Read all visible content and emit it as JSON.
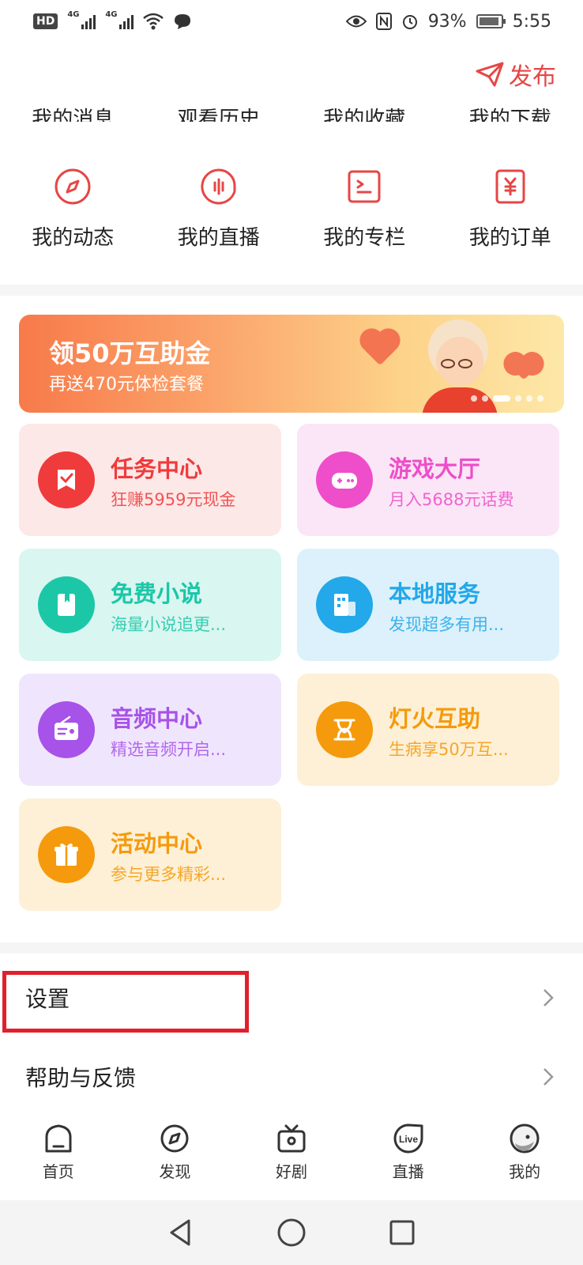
{
  "status_bar": {
    "network_badge": "HD",
    "sim1": "4G",
    "sim2": "4G",
    "battery": "93%",
    "battery_level": 0.93,
    "time": "5:55"
  },
  "header": {
    "publish_label": "发布"
  },
  "partial_row": [
    "我的消息",
    "观看历史",
    "我的收藏",
    "我的下载"
  ],
  "shortcuts": [
    {
      "label": "我的动态",
      "icon": "compass-icon"
    },
    {
      "label": "我的直播",
      "icon": "voice-play-icon"
    },
    {
      "label": "我的专栏",
      "icon": "column-icon"
    },
    {
      "label": "我的订单",
      "icon": "yuan-order-icon"
    }
  ],
  "banner": {
    "title": "领50万互助金",
    "subtitle": "再送470元体检套餐",
    "active_page": 3,
    "page_count": 6
  },
  "cards": [
    {
      "title": "任务中心",
      "sub": "狂赚5959元现金",
      "icon": "task-icon",
      "color": "#ef3b3b",
      "bg": "#fde8e8"
    },
    {
      "title": "游戏大厅",
      "sub": "月入5688元话费",
      "icon": "gamepad-icon",
      "color": "#ee4ec9",
      "bg": "#fbe6f7"
    },
    {
      "title": "免费小说",
      "sub": "海量小说追更...",
      "icon": "book-icon",
      "color": "#1cc7a8",
      "bg": "#d9f6f1"
    },
    {
      "title": "本地服务",
      "sub": "发现超多有用...",
      "icon": "building-icon",
      "color": "#23a8e9",
      "bg": "#dcf1fb"
    },
    {
      "title": "音频中心",
      "sub": "精选音频开启...",
      "icon": "radio-icon",
      "color": "#a752e8",
      "bg": "#efe6fd"
    },
    {
      "title": "灯火互助",
      "sub": "生病享50万互...",
      "icon": "mutual-aid-icon",
      "color": "#f59a0c",
      "bg": "#fdf0d6"
    },
    {
      "title": "活动中心",
      "sub": "参与更多精彩...",
      "icon": "gift-icon",
      "color": "#f59a0c",
      "bg": "#fdf0d6"
    }
  ],
  "list": [
    {
      "label": "设置"
    },
    {
      "label": "帮助与反馈"
    }
  ],
  "tabs": [
    {
      "label": "首页",
      "icon": "home-icon"
    },
    {
      "label": "发现",
      "icon": "discover-icon"
    },
    {
      "label": "好剧",
      "icon": "tv-icon"
    },
    {
      "label": "直播",
      "icon": "live-icon"
    },
    {
      "label": "我的",
      "icon": "avatar-icon"
    }
  ],
  "colors": {
    "accent": "#e64646",
    "highlight_box": "#e0202b"
  }
}
